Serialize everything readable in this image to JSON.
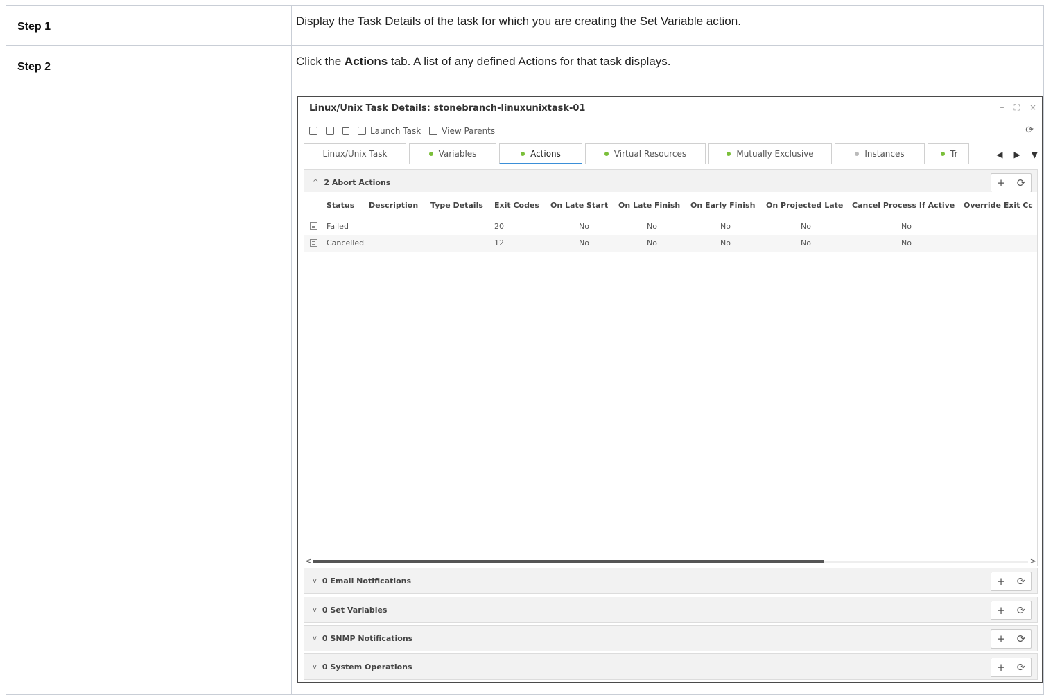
{
  "doc": {
    "steps": [
      {
        "label": "Step 1",
        "text": "Display the Task Details of the task for which you are creating the Set Variable action."
      },
      {
        "label": "Step 2",
        "text_before": "Click the ",
        "text_bold": "Actions",
        "text_after": " tab. A list of any defined Actions for that task displays."
      }
    ]
  },
  "window": {
    "title": "Linux/Unix Task Details: stonebranch-linuxunixtask-01",
    "controls": [
      "–",
      "⛶",
      "×"
    ],
    "toolbar": {
      "save_icon": "save-icon",
      "copy_icon": "copy-icon",
      "delete_icon": "delete-icon",
      "launch_label": "Launch Task",
      "view_parents_label": "View Parents",
      "refresh_icon": "refresh-icon"
    },
    "tabs": [
      {
        "label": "Linux/Unix Task",
        "dot": "none"
      },
      {
        "label": "Variables",
        "dot": "green"
      },
      {
        "label": "Actions",
        "dot": "green",
        "active": true
      },
      {
        "label": "Virtual Resources",
        "dot": "green"
      },
      {
        "label": "Mutually Exclusive",
        "dot": "green"
      },
      {
        "label": "Instances",
        "dot": "grey"
      },
      {
        "label": "Tr",
        "dot": "green"
      }
    ],
    "tab_nav": {
      "left": "◀",
      "right": "▶",
      "menu": "▼"
    },
    "abort_section": {
      "title": "2 Abort Actions",
      "columns": [
        "Status",
        "Description",
        "Type Details",
        "Exit Codes",
        "On Late Start",
        "On Late Finish",
        "On Early Finish",
        "On Projected Late",
        "Cancel Process If Active",
        "Override Exit Cc"
      ],
      "rows": [
        {
          "status": "Failed",
          "description": "",
          "type_details": "",
          "exit_codes": "20",
          "late_start": "No",
          "late_finish": "No",
          "early_finish": "No",
          "projected_late": "No",
          "cancel": "No",
          "override": ""
        },
        {
          "status": "Cancelled",
          "description": "",
          "type_details": "",
          "exit_codes": "12",
          "late_start": "No",
          "late_finish": "No",
          "early_finish": "No",
          "projected_late": "No",
          "cancel": "No",
          "override": ""
        }
      ]
    },
    "collapsed_sections": [
      {
        "title": "0 Email Notifications"
      },
      {
        "title": "0 Set Variables"
      },
      {
        "title": "0 SNMP Notifications"
      },
      {
        "title": "0 System Operations"
      }
    ],
    "section_buttons": {
      "add": "+",
      "refresh": "⟳"
    }
  }
}
